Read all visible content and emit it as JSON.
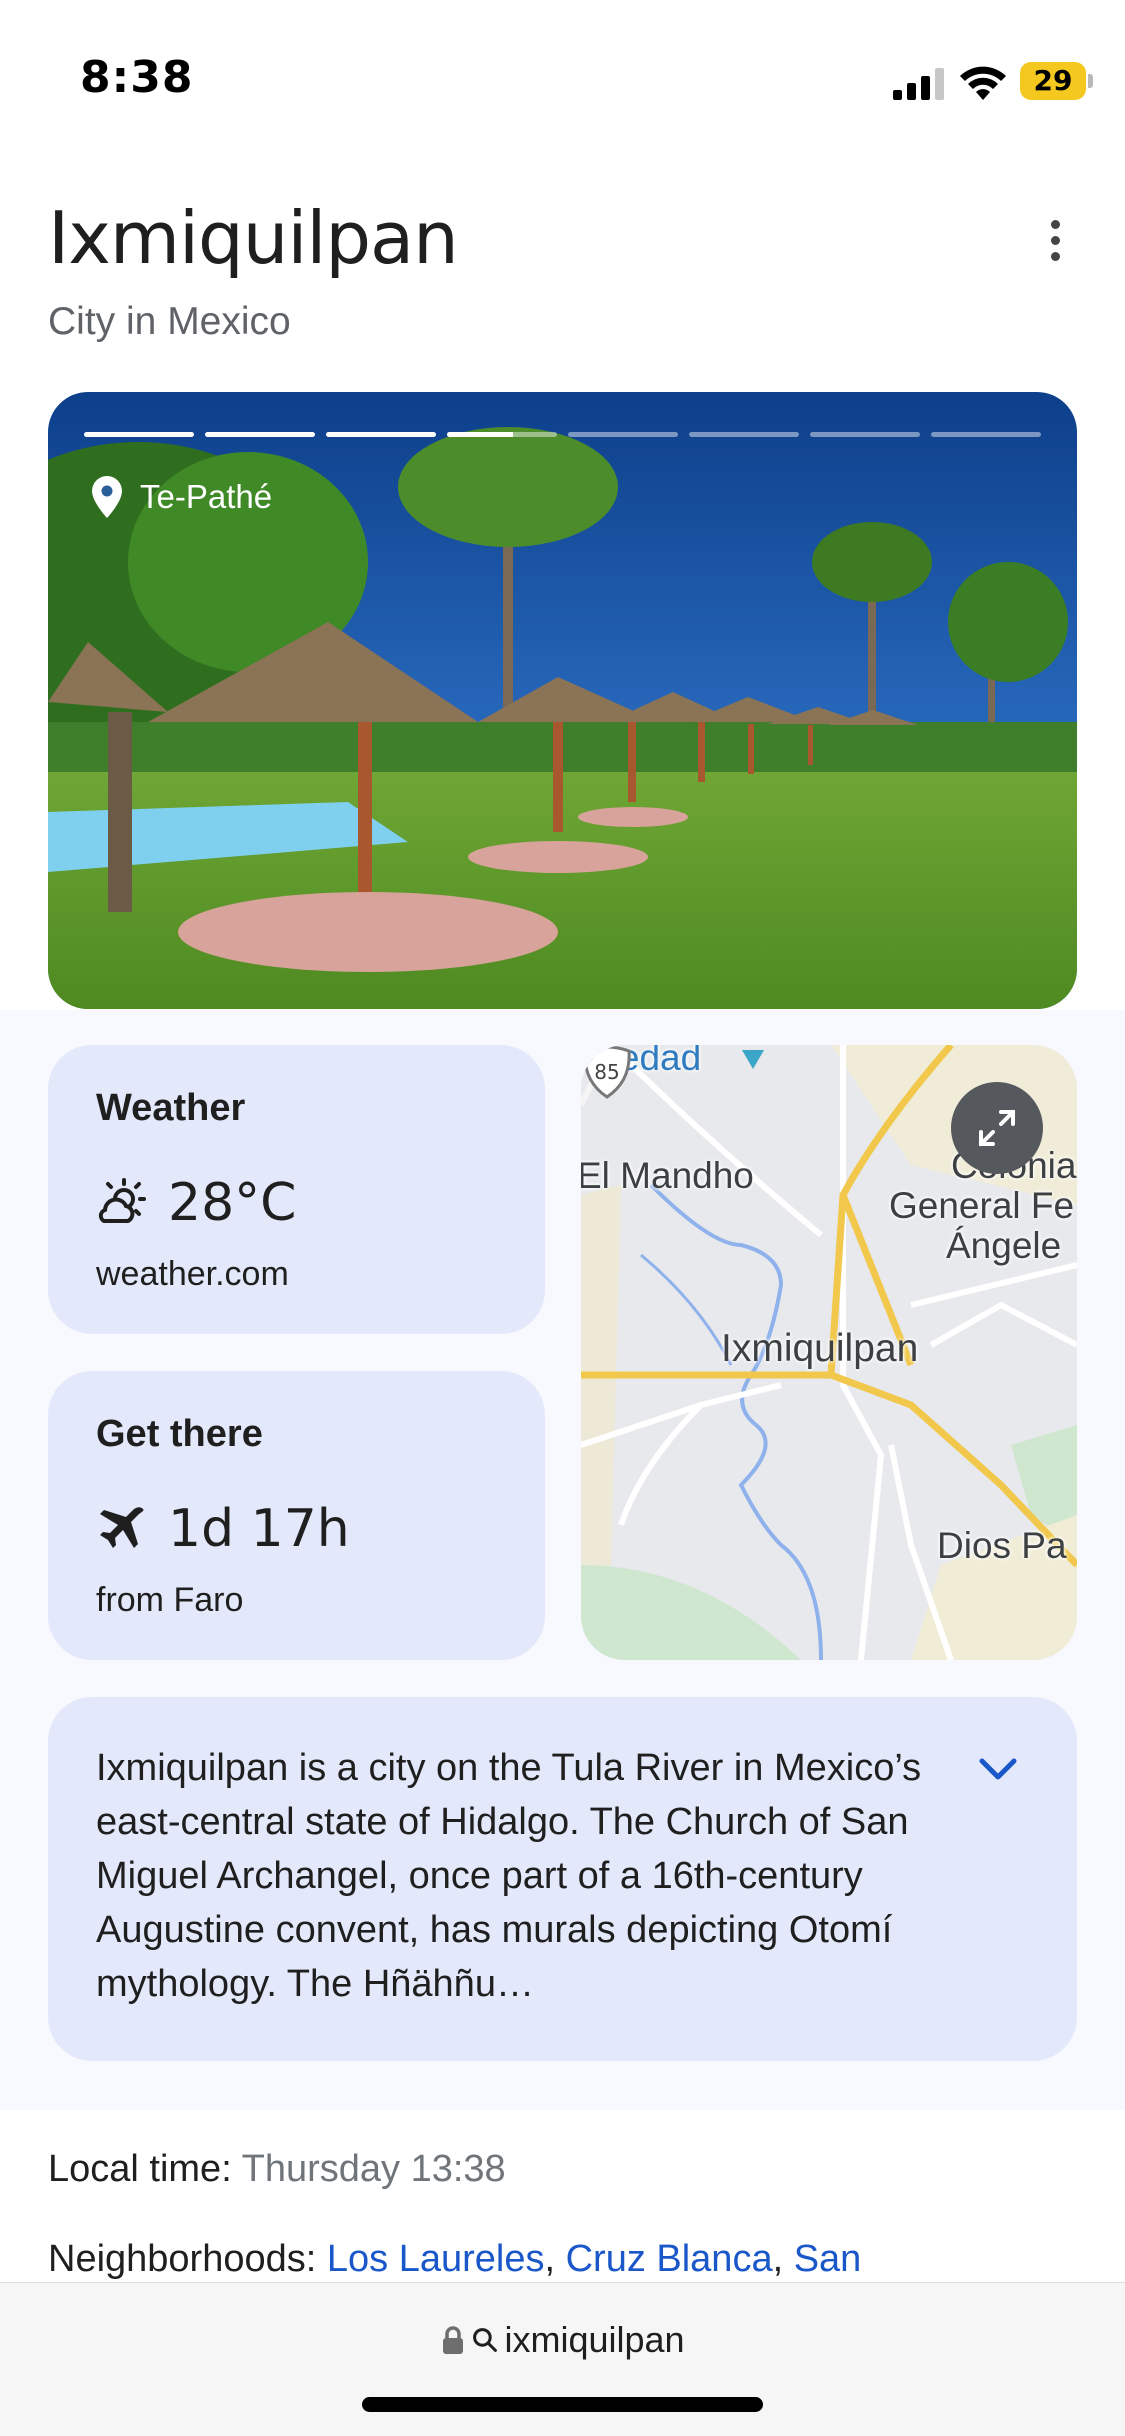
{
  "status_bar": {
    "time": "8:38",
    "battery": "29",
    "battery_color": "#f4c81f",
    "icons": [
      "signal-icon",
      "wifi-icon",
      "battery-icon"
    ]
  },
  "header": {
    "title": "Ixmiquilpan",
    "subtitle": "City in Mexico",
    "more_icon": "more-vert-icon"
  },
  "hero": {
    "location_label": "Te-Pathé",
    "story_segments": 8,
    "story_progress": [
      1,
      1,
      1,
      0.6,
      0,
      0,
      0,
      0
    ]
  },
  "weather": {
    "title": "Weather",
    "temperature": "28°C",
    "source": "weather.com",
    "icon": "partly-cloudy-icon"
  },
  "get_there": {
    "title": "Get there",
    "duration": "1d 17h",
    "origin": "from Faro",
    "icon": "airplane-icon"
  },
  "map": {
    "labels": {
      "top": "eredad",
      "west": "El Mandho",
      "colonia": "Colonia",
      "general": "General Fe",
      "angele": "Ángele",
      "center": "Ixmiquilpan",
      "south_east": "Dios Pa"
    },
    "highway": "85",
    "expand_icon": "expand-icon"
  },
  "description": {
    "text": "Ixmiquilpan is a city on the Tula River in Mexico’s east-central state of Hidalgo. The Church of San Miguel Archangel, once part of a 16th-century Augustine convent, has murals depicting Otomí mythology. The Hñähñu…",
    "expand_icon": "chevron-down-icon"
  },
  "facts": {
    "local_time_label": "Local time:",
    "local_time_value": "Thursday 13:38",
    "neighborhoods_label": "Neighborhoods:",
    "neighborhoods": [
      "Los Laureles",
      "Cruz Blanca",
      "San"
    ],
    "separator": ", "
  },
  "browser": {
    "url": "ixmiquilpan",
    "icons": [
      "lock-icon",
      "search-icon"
    ]
  },
  "colors": {
    "card_bg": "#e4e8fb",
    "link": "#1a57c9",
    "page_bg": "#ffffff",
    "section_bg": "#f8f9fe"
  }
}
